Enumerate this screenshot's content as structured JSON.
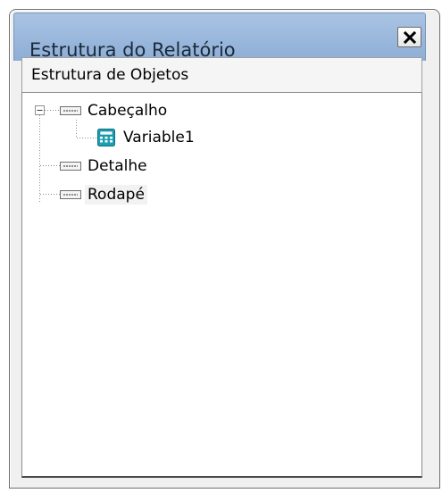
{
  "window": {
    "title": "Estrutura do Relatório",
    "close_glyph": "✕"
  },
  "panel": {
    "header": "Estrutura de Objetos"
  },
  "tree": {
    "nodes": [
      {
        "label": "Cabeçalho",
        "icon": "band-icon",
        "expanded": true,
        "level": 0
      },
      {
        "label": "Variable1",
        "icon": "calculator-variable-icon",
        "level": 1
      },
      {
        "label": "Detalhe",
        "icon": "band-icon",
        "level": 0
      },
      {
        "label": "Rodapé",
        "icon": "band-icon",
        "level": 0,
        "selected": true
      }
    ]
  },
  "colors": {
    "title_bar": "#9bb9df",
    "window_body": "#f0f0f0",
    "variable_icon_teal": "#1d9fb3"
  }
}
